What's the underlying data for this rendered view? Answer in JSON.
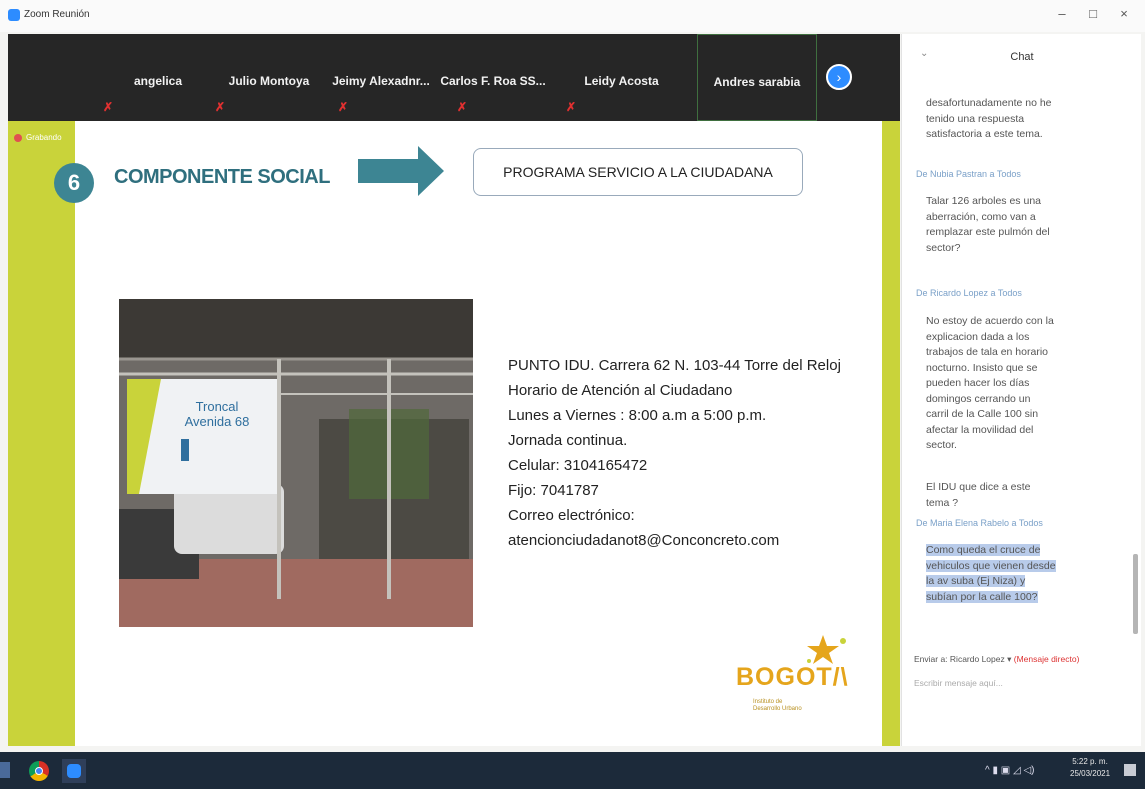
{
  "window": {
    "title": "Zoom Reunión",
    "minimize": "–",
    "maximize": "□",
    "close": "×"
  },
  "participants": [
    {
      "name": "angelica",
      "muted": true
    },
    {
      "name": "Julio Montoya",
      "muted": true
    },
    {
      "name": "Jeimy Alexadnr...",
      "muted": true
    },
    {
      "name": "Carlos F. Roa SS...",
      "muted": true
    },
    {
      "name": "Leidy Acosta",
      "muted": true
    },
    {
      "name": "Andres sarabia",
      "muted": false
    }
  ],
  "next_icon": "›",
  "mute_icon": "✗",
  "slide": {
    "recording_label": "Grabando",
    "number": "6",
    "heading": "COMPONENTE SOCIAL",
    "program": "PROGRAMA SERVICIO A LA CIUDADANA",
    "photo_sign": {
      "line1": "Troncal",
      "line2": "Avenida 68"
    },
    "info_lines": [
      "PUNTO IDU. Carrera 62 N. 103-44 Torre del Reloj",
      "Horario de Atención al Ciudadano",
      "Lunes a Viernes : 8:00 a.m a 5:00 p.m.",
      "Jornada continua.",
      "Celular: 3104165472",
      "Fijo: 7041787",
      "Correo electrónico:",
      "atencionciudadanot8@Conconcreto.com"
    ],
    "logo": {
      "word": "BOGOT/\\",
      "sub1": "Instituto de",
      "sub2": "Desarrollo Urbano"
    },
    "colors": {
      "accent": "#c9d33a",
      "teal": "#3d8593",
      "heading": "#2f6f7e"
    }
  },
  "chat": {
    "chevron": "⌄",
    "title": "Chat",
    "first_msg": "desafortunadamente no he tenido una respuesta satisfactoria a este tema.",
    "messages": [
      {
        "from": "De Nubia Pastran a Todos",
        "text": "Talar 126 arboles es una aberración, como van a remplazar este pulmón del sector?"
      },
      {
        "from": "De Ricardo Lopez a Todos",
        "text": "No estoy de acuerdo con la explicacion dada a los trabajos de tala en horario nocturno. Insisto que se pueden hacer los días domingos cerrando un carril de la Calle 100 sin afectar la movilidad del sector."
      },
      {
        "from": "",
        "text": "El IDU que dice a este tema ?"
      },
      {
        "from": "De Maria Elena Rabelo a Todos",
        "text": "Como queda el cruce de vehiculos que vienen desde la av suba (Ej Niza) y subían por la calle 100?"
      }
    ],
    "send_to_label": "Enviar a:",
    "send_to_value": "Ricardo Lopez ▾",
    "direct_label": "(Mensaje directo)",
    "placeholder": "Escribir mensaje aquí..."
  },
  "taskbar": {
    "tray_icons": "^ ▮ ▣ ◿ ◁)",
    "time": "5:22 p. m.",
    "date": "25/03/2021"
  }
}
